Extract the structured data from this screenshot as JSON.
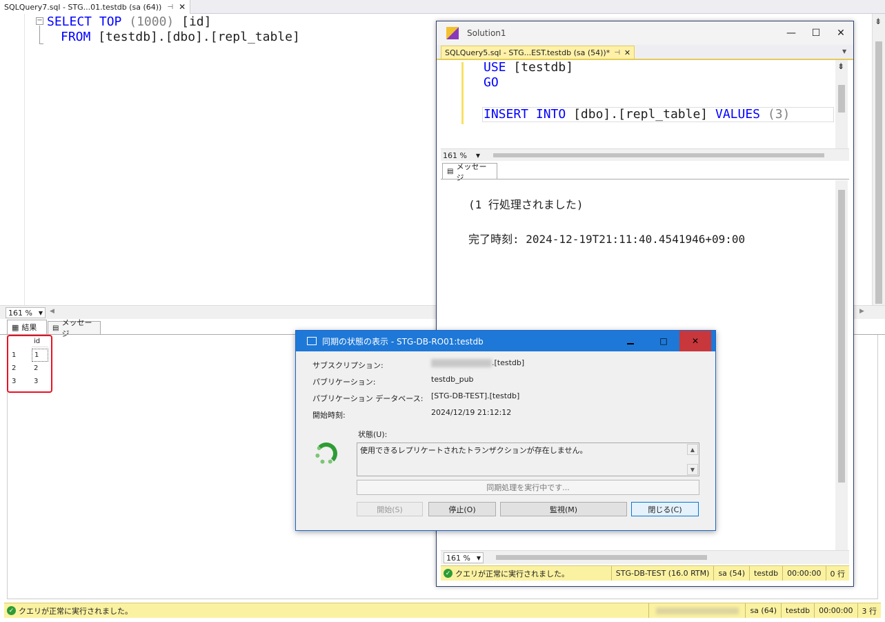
{
  "left_tab": {
    "title": "SQLQuery7.sql - STG...01.testdb (sa (64))",
    "pin": "⊣",
    "close": "✕"
  },
  "left_editor": {
    "line1": [
      "SELECT",
      "TOP",
      "(1000)",
      "[id]"
    ],
    "line2": [
      "FROM",
      "[testdb].[dbo].[repl_table]"
    ]
  },
  "left_zoom": "161 %",
  "result_tabs": [
    "結果",
    "メッセージ"
  ],
  "grid": {
    "header": "id",
    "rows": [
      {
        "n": "1",
        "v": "1"
      },
      {
        "n": "2",
        "v": "2"
      },
      {
        "n": "3",
        "v": "3"
      }
    ]
  },
  "left_status": {
    "text": "クエリが正常に実行されました。",
    "user": "sa (64)",
    "db": "testdb",
    "time": "00:00:00",
    "rows": "3 行"
  },
  "win2": {
    "title": "Solution1",
    "tab": "SQLQuery5.sql - STG...EST.testdb (sa (54))*",
    "code": {
      "use": "USE",
      "db": "[testdb]",
      "go": "GO",
      "insert": "INSERT",
      "into": "INTO",
      "target": "[dbo].[repl_table]",
      "values": "VALUES",
      "val": "(3)"
    },
    "zoom": "161 %",
    "msg_tab": "メッセージ",
    "msg1": "(1 行処理されました)",
    "msg2": "完了時刻: 2024-12-19T21:11:40.4541946+09:00",
    "zoom2": "161 %",
    "status": {
      "text": "クエリが正常に実行されました。",
      "server": "STG-DB-TEST (16.0 RTM)",
      "user": "sa (54)",
      "db": "testdb",
      "time": "00:00:00",
      "rows": "0 行"
    }
  },
  "dialog": {
    "title": "同期の状態の表示 - STG-DB-RO01:testdb",
    "subscription_label": "サブスクリプション:",
    "subscription_value": ".[testdb]",
    "publication_label": "パブリケーション:",
    "publication_value": "testdb_pub",
    "pubdb_label": "パブリケーション データベース:",
    "pubdb_value": "[STG-DB-TEST].[testdb]",
    "start_label": "開始時刻:",
    "start_value": "2024/12/19 21:12:12",
    "status_label": "状態(U):",
    "status_text": "使用できるレプリケートされたトランザクションが存在しません。",
    "progress_text": "同期処理を実行中です...",
    "buttons": {
      "start": "開始(S)",
      "stop": "停止(O)",
      "monitor": "監視(M)",
      "close": "閉じる(C)"
    }
  },
  "colors": {
    "accent": "#1e78d7",
    "status_bar": "#fbf2a1",
    "keyword": "#0000ff",
    "highlight": "#e81123"
  }
}
